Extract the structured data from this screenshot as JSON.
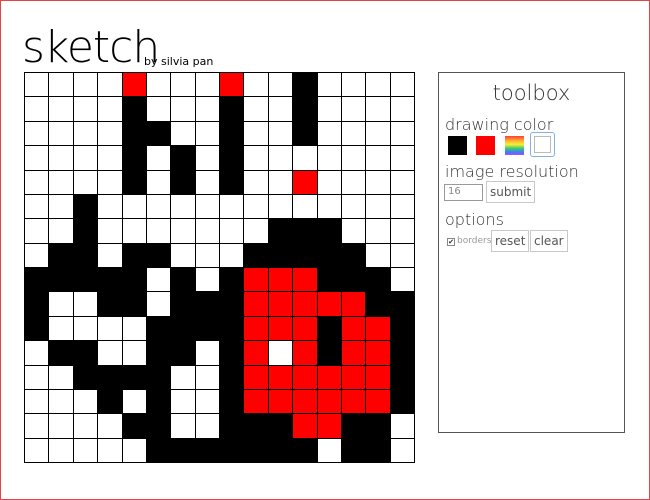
{
  "header": {
    "title": "sketch",
    "byline": "by silvia pan"
  },
  "colors": {
    "accent_red": "#ff0000",
    "grid_line": "#000000",
    "frame_red": "#e34545"
  },
  "canvas": {
    "rows": [
      "....R...R..B....",
      "....B...B..B....",
      "....BB..B..B....",
      "....B.B.B.......",
      "....B.B.B..R....",
      "..B.............",
      "..B.......BBB...",
      ".BB.BB...BBBBB..",
      "BBBBB.B.BRRRBBB.",
      "B..BB.BBBRRRRRBB",
      "B....BBBBRRRBRRB",
      ".BB..BB.BR.RBRRB",
      "..BBBB..BRRRRRRB",
      "...B.B..BRRRRRRB",
      "....BB..BBBRRBB.",
      ".....BBBBBBB.BB."
    ]
  },
  "toolbox": {
    "title": "toolbox",
    "drawing_color_label": "drawing color",
    "swatches": [
      {
        "name": "black",
        "color": "#000000"
      },
      {
        "name": "red",
        "color": "#ff0000"
      },
      {
        "name": "rainbow",
        "color": "rainbow"
      },
      {
        "name": "white",
        "color": "#ffffff",
        "selected": true
      }
    ],
    "image_resolution_label": "image resolution",
    "resolution_value": "16",
    "submit_label": "submit",
    "options_label": "options",
    "borders_label": "borders",
    "borders_checked": true,
    "reset_label": "reset",
    "clear_label": "clear"
  }
}
